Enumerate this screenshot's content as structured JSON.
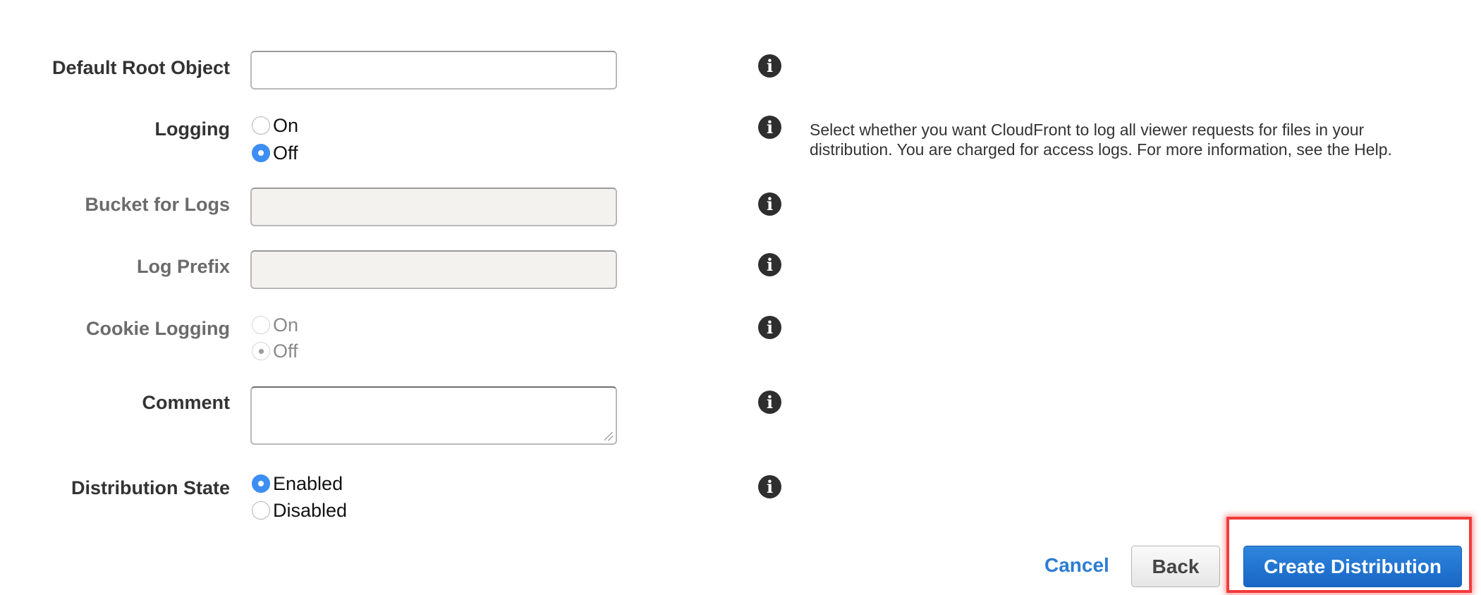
{
  "form": {
    "default_root_object": {
      "label": "Default Root Object",
      "value": "",
      "info_icon": "info-icon"
    },
    "logging": {
      "label": "Logging",
      "options": [
        {
          "label": "On",
          "checked": false
        },
        {
          "label": "Off",
          "checked": true
        }
      ],
      "help_text": "Select whether you want CloudFront to log all viewer requests for files in your distribution. You are charged for access logs. For more information, see the Help.",
      "info_icon": "info-icon"
    },
    "bucket_for_logs": {
      "label": "Bucket for Logs",
      "value": "",
      "disabled": true,
      "info_icon": "info-icon"
    },
    "log_prefix": {
      "label": "Log Prefix",
      "value": "",
      "disabled": true,
      "info_icon": "info-icon"
    },
    "cookie_logging": {
      "label": "Cookie Logging",
      "disabled": true,
      "options": [
        {
          "label": "On",
          "checked": false
        },
        {
          "label": "Off",
          "checked": true
        }
      ],
      "info_icon": "info-icon"
    },
    "comment": {
      "label": "Comment",
      "value": "",
      "info_icon": "info-icon"
    },
    "distribution_state": {
      "label": "Distribution State",
      "options": [
        {
          "label": "Enabled",
          "checked": true
        },
        {
          "label": "Disabled",
          "checked": false
        }
      ],
      "info_icon": "info-icon"
    }
  },
  "info_glyph": "i",
  "actions": {
    "cancel_label": "Cancel",
    "back_label": "Back",
    "create_label": "Create Distribution",
    "highlight_color": "#f23b3b"
  },
  "colors": {
    "primary_button": "#1e6fcc",
    "radio_checked": "#3c8ef3",
    "link": "#2b7cd3"
  }
}
